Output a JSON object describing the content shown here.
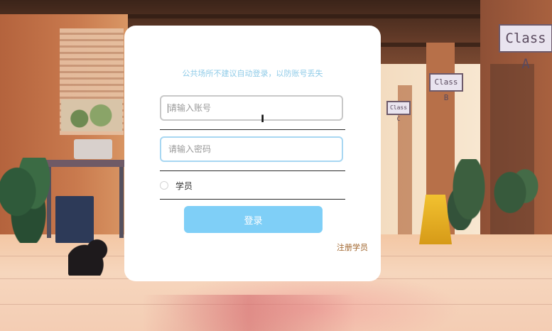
{
  "background": {
    "signs": [
      "Class A",
      "Class B",
      "Class C"
    ]
  },
  "login": {
    "tip": "公共场所不建议自动登录，以防账号丢失",
    "account_placeholder": "请输入账号",
    "password_placeholder": "请输入密码",
    "role_option": "学员",
    "login_button": "登录",
    "register_link": "注册学员"
  },
  "colors": {
    "accent": "#7fcff7",
    "tip": "#8fcbe8",
    "link": "#a0642b"
  },
  "icons": {
    "cursor": "text-cursor-icon"
  }
}
